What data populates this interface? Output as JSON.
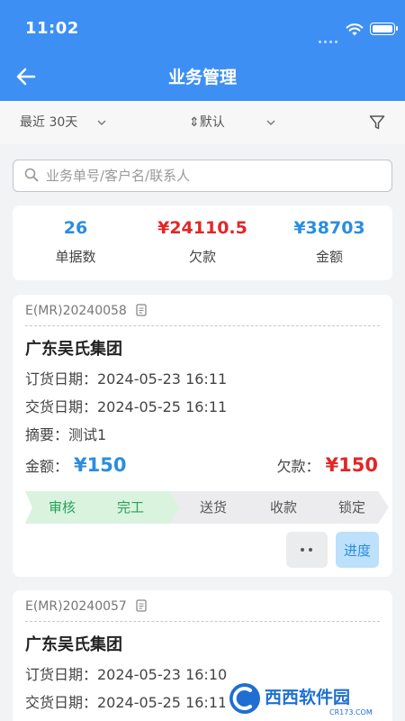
{
  "status_bar": {
    "time": "11:02"
  },
  "header": {
    "title": "业务管理",
    "back_icon": "arrow-left-icon"
  },
  "filters": {
    "date_range": "最近 30天",
    "sort": "⇕默认"
  },
  "search": {
    "placeholder": "业务单号/客户名/联系人",
    "value": ""
  },
  "summary": {
    "count": {
      "value": "26",
      "label": "单据数"
    },
    "debt": {
      "value": "¥24110.5",
      "label": "欠款"
    },
    "amount": {
      "value": "¥38703",
      "label": "金额"
    }
  },
  "cards": [
    {
      "doc_no": "E(MR)20240058",
      "customer": "广东吴氏集团",
      "order_date": "订货日期：2024-05-23 16:11",
      "delivery_date": "交货日期：2024-05-25 16:11",
      "summary": "摘要：测试1",
      "amount_label": "金额：",
      "amount_value": "¥150",
      "debt_label": "欠款：",
      "debt_value": "¥150",
      "steps": [
        "审核",
        "完工",
        "送货",
        "收款",
        "锁定"
      ],
      "more_label": "••",
      "progress_label": "进度"
    },
    {
      "doc_no": "E(MR)20240057",
      "customer": "广东吴氏集团",
      "order_date": "订货日期：2024-05-23 16:10",
      "delivery_date": "交货日期：2024-05-25 16:11"
    }
  ],
  "watermark": {
    "text": "西西软件园",
    "sub": "CR173.COM"
  },
  "colors": {
    "primary": "#3d8ff4",
    "red": "#e32626",
    "blue": "#2b8de0",
    "green": "#27a35a"
  }
}
